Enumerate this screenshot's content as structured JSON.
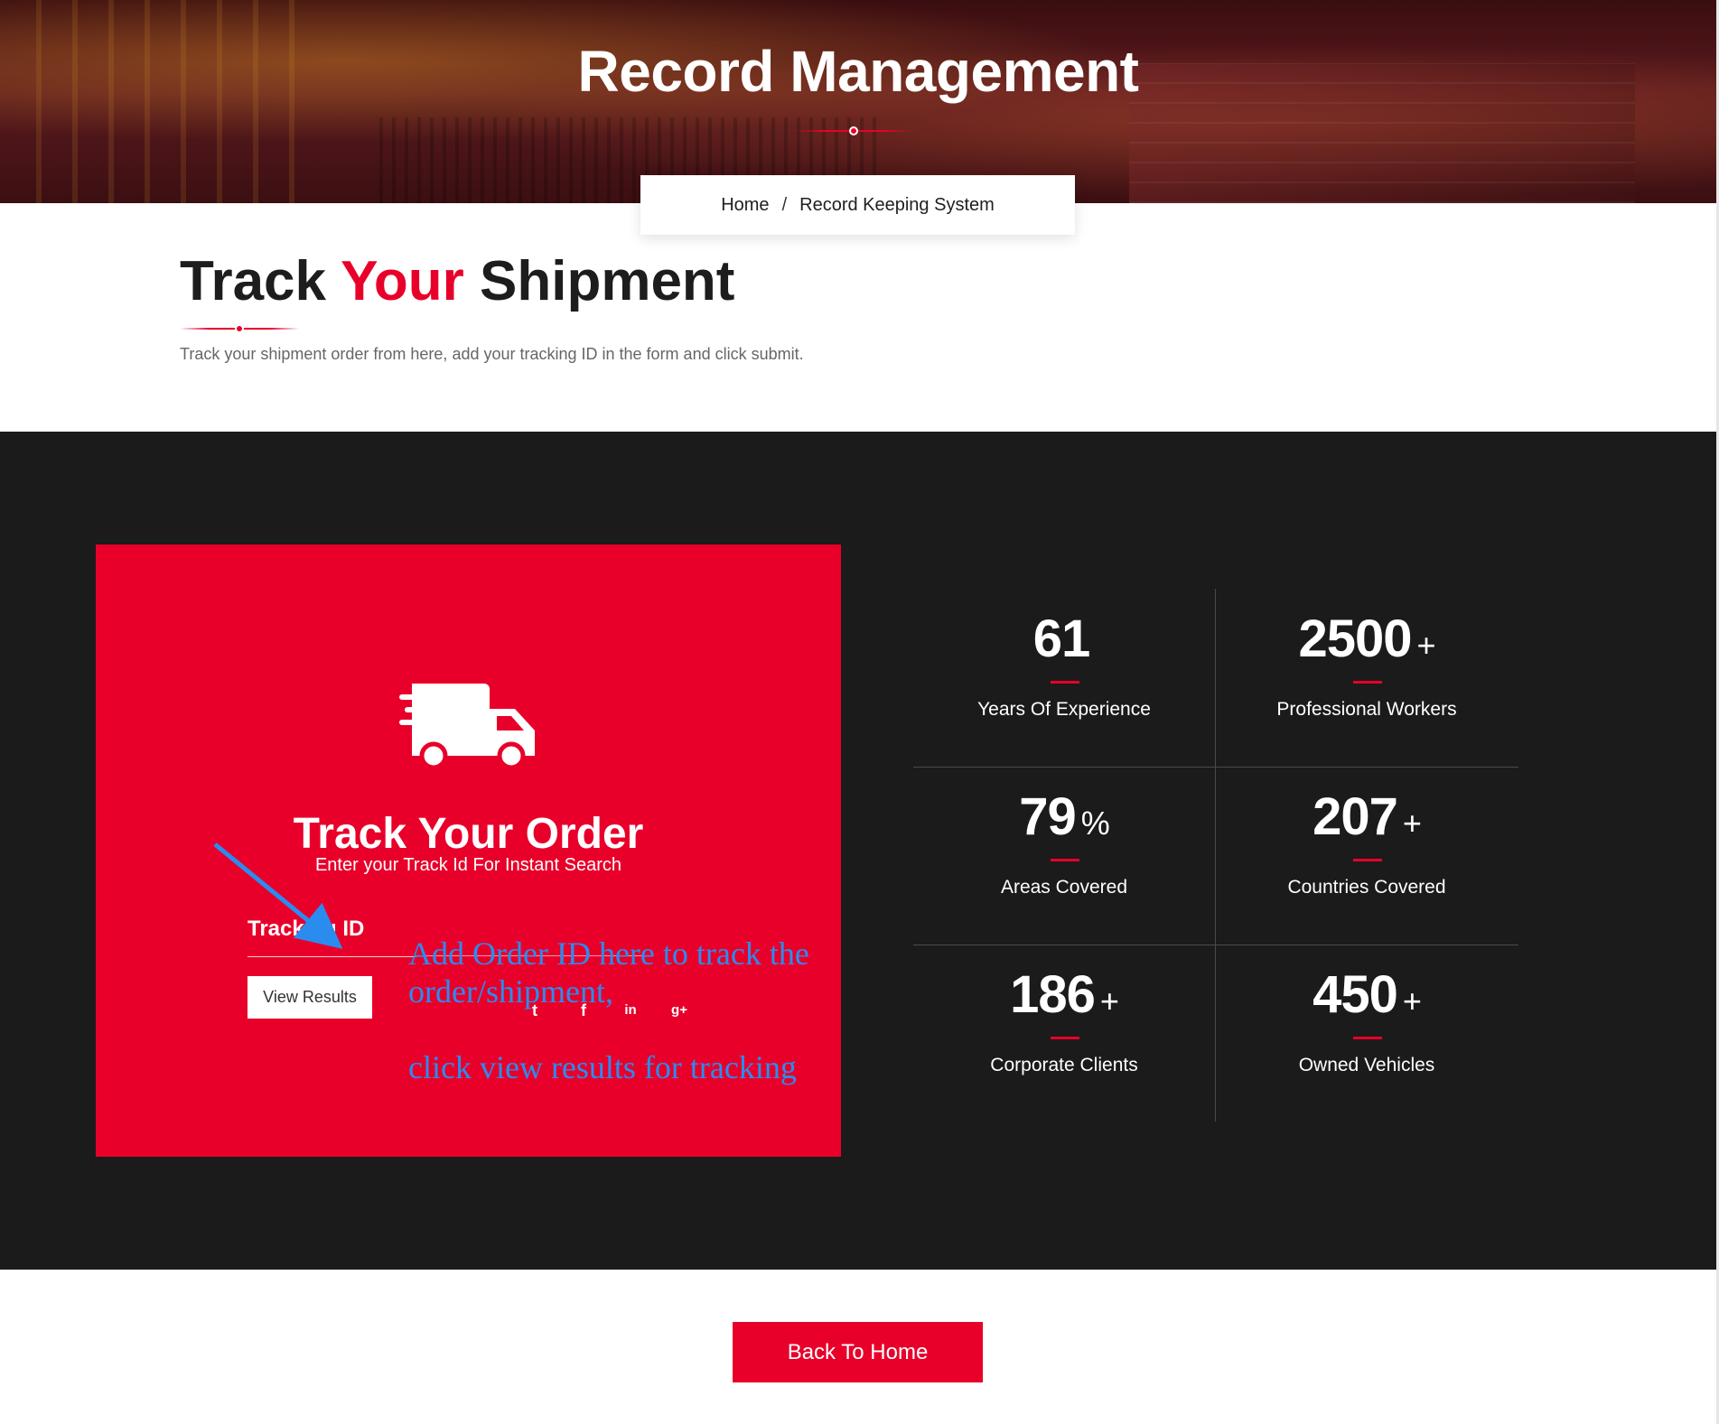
{
  "hero": {
    "title": "Record Management"
  },
  "breadcrumb": {
    "home": "Home",
    "separator": "/",
    "current": "Record Keeping System"
  },
  "track_shipment": {
    "title_part1": "Track ",
    "title_accent": "Your",
    "title_part2": " Shipment",
    "description": "Track your shipment order from here, add your tracking ID in the form and click submit."
  },
  "order_card": {
    "icon": "truck-icon",
    "title": "Track Your Order",
    "subtitle": "Enter your Track Id For Instant Search",
    "tracking_label": "Tracking ID",
    "tracking_value": "",
    "button_label": "View Results",
    "social_icons": [
      "twitter-icon",
      "facebook-icon",
      "linkedin-icon",
      "google-plus-icon"
    ],
    "social_glyphs": [
      "t",
      "f",
      "in",
      "g+"
    ]
  },
  "annotation": {
    "line1": "Add Order ID here to track the",
    "line2": "order/shipment,",
    "line3": "click view results for tracking",
    "color": "#2b8cf0"
  },
  "stats": [
    {
      "number": "61",
      "suffix": "",
      "label": "Years Of Experience"
    },
    {
      "number": "2500",
      "suffix": "+",
      "label": "Professional Workers"
    },
    {
      "number": "79",
      "suffix": "%",
      "label": "Areas Covered"
    },
    {
      "number": "207",
      "suffix": "+",
      "label": "Countries Covered"
    },
    {
      "number": "186",
      "suffix": "+",
      "label": "Corporate Clients"
    },
    {
      "number": "450",
      "suffix": "+",
      "label": "Owned Vehicles"
    }
  ],
  "back_button": {
    "label": "Back To Home"
  },
  "colors": {
    "accent": "#e8002a",
    "dark": "#1b1b1b",
    "text": "#1d1d1d"
  }
}
